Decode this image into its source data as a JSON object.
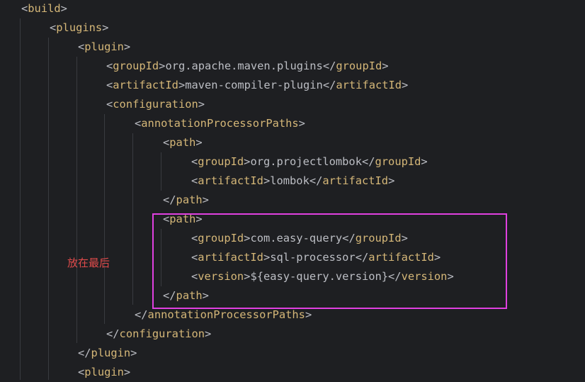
{
  "editor": {
    "lines": [
      {
        "tag": "build",
        "closing": false
      },
      {
        "tag": "plugins",
        "closing": false
      },
      {
        "tag": "plugin",
        "closing": false
      },
      {
        "tag": "groupId",
        "value": "org.apache.maven.plugins"
      },
      {
        "tag": "artifactId",
        "value": "maven-compiler-plugin"
      },
      {
        "tag": "configuration",
        "closing": false
      },
      {
        "tag": "annotationProcessorPaths",
        "closing": false
      },
      {
        "tag": "path",
        "closing": false
      },
      {
        "tag": "groupId",
        "value": "org.projectlombok"
      },
      {
        "tag": "artifactId",
        "value": "lombok"
      },
      {
        "tag": "path",
        "closing": true
      },
      {
        "tag": "path",
        "closing": false
      },
      {
        "tag": "groupId",
        "value": "com.easy-query"
      },
      {
        "tag": "artifactId",
        "value": "sql-processor"
      },
      {
        "tag": "version",
        "value": "${easy-query.version}"
      },
      {
        "tag": "path",
        "closing": true
      },
      {
        "tag": "annotationProcessorPaths",
        "closing": true
      },
      {
        "tag": "configuration",
        "closing": true
      },
      {
        "tag": "plugin",
        "closing": true
      },
      {
        "tag": "plugin",
        "closing": false
      }
    ]
  },
  "annotation": {
    "text": "放在最后"
  },
  "colors": {
    "background": "#1e1f22",
    "tag": "#d5b778",
    "bracket": "#bcbec4",
    "text": "#bcbec4",
    "highlight_box": "#e040e0",
    "annotation": "#e04b4b"
  }
}
